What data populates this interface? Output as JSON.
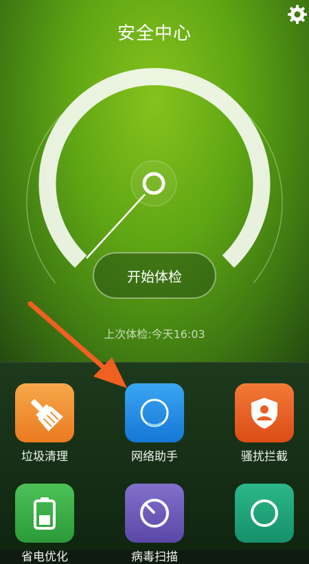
{
  "header": {
    "title": "安全中心",
    "settings_icon": "gear-icon"
  },
  "main": {
    "gauge": {
      "needle_level": 0.0
    },
    "start_button_label": "开始体检",
    "last_check": "上次体检:今天16:03"
  },
  "grid": {
    "items": [
      {
        "label": "垃圾清理",
        "icon": "broom-icon",
        "color": "#f08b2c"
      },
      {
        "label": "网络助手",
        "icon": "network-ring-icon",
        "color": "#1f8ee6"
      },
      {
        "label": "骚扰拦截",
        "icon": "shield-user-icon",
        "color": "#e85f24"
      },
      {
        "label": "省电优化",
        "icon": "battery-icon",
        "color": "#3aa845"
      },
      {
        "label": "病毒扫描",
        "icon": "scan-dial-icon",
        "color": "#6a58b8"
      },
      {
        "label": "",
        "icon": "green-app-icon",
        "color": "#22a07a"
      }
    ]
  },
  "overlay": {
    "arrow_color": "#f06020"
  }
}
